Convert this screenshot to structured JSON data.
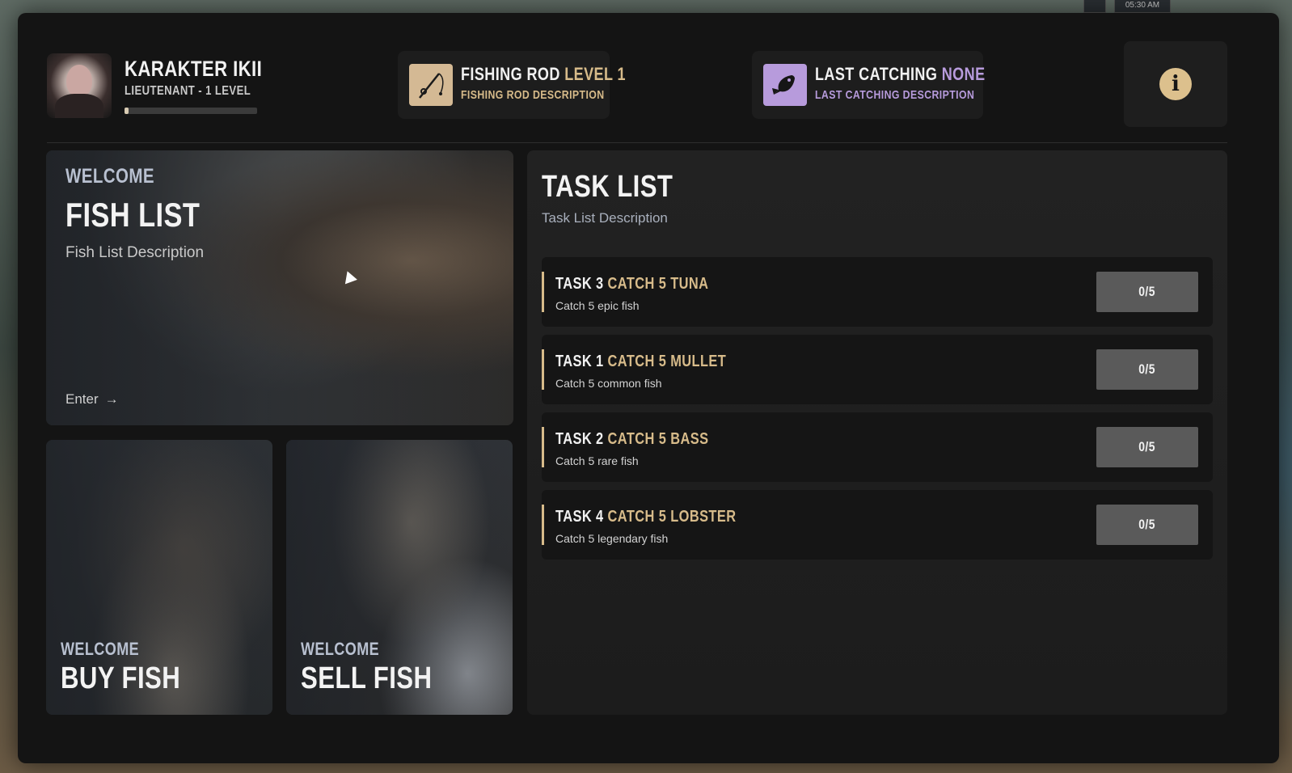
{
  "hud": {
    "clock": "05:30 AM"
  },
  "player": {
    "name": "KARAKTER IKII",
    "rank": "LIEUTENANT - 1 LEVEL",
    "xp_fraction": 0.03
  },
  "fishing_rod": {
    "title": "FISHING ROD",
    "level": "LEVEL 1",
    "description": "FISHING ROD DESCRIPTION",
    "icon": "fishing-rod-icon"
  },
  "last_catching": {
    "title": "LAST CATCHING",
    "value": "NONE",
    "description": "LAST CATCHING DESCRIPTION",
    "icon": "fish-icon"
  },
  "info_button": {
    "label": "i"
  },
  "fish_list": {
    "kicker": "WELCOME",
    "title": "FISH LIST",
    "description": "Fish List Description",
    "enter": "Enter",
    "arrow": "→"
  },
  "buy_fish": {
    "kicker": "WELCOME",
    "title": "BUY FISH"
  },
  "sell_fish": {
    "kicker": "WELCOME",
    "title": "SELL FISH"
  },
  "task_list": {
    "title": "TASK LIST",
    "description": "Task List Description",
    "tasks": [
      {
        "label": "TASK 3",
        "goal": "CATCH 5 TUNA",
        "sub": "Catch 5 epic fish",
        "progress": "0/5"
      },
      {
        "label": "TASK 1",
        "goal": "CATCH 5 MULLET",
        "sub": "Catch 5 common fish",
        "progress": "0/5"
      },
      {
        "label": "TASK 2",
        "goal": "CATCH 5 BASS",
        "sub": "Catch 5 rare fish",
        "progress": "0/5"
      },
      {
        "label": "TASK 4",
        "goal": "CATCH 5 LOBSTER",
        "sub": "Catch 5 legendary fish",
        "progress": "0/5"
      }
    ]
  },
  "colors": {
    "accent_gold": "#d7bb8a",
    "accent_purple": "#b79bdc",
    "panel": "#141414"
  }
}
